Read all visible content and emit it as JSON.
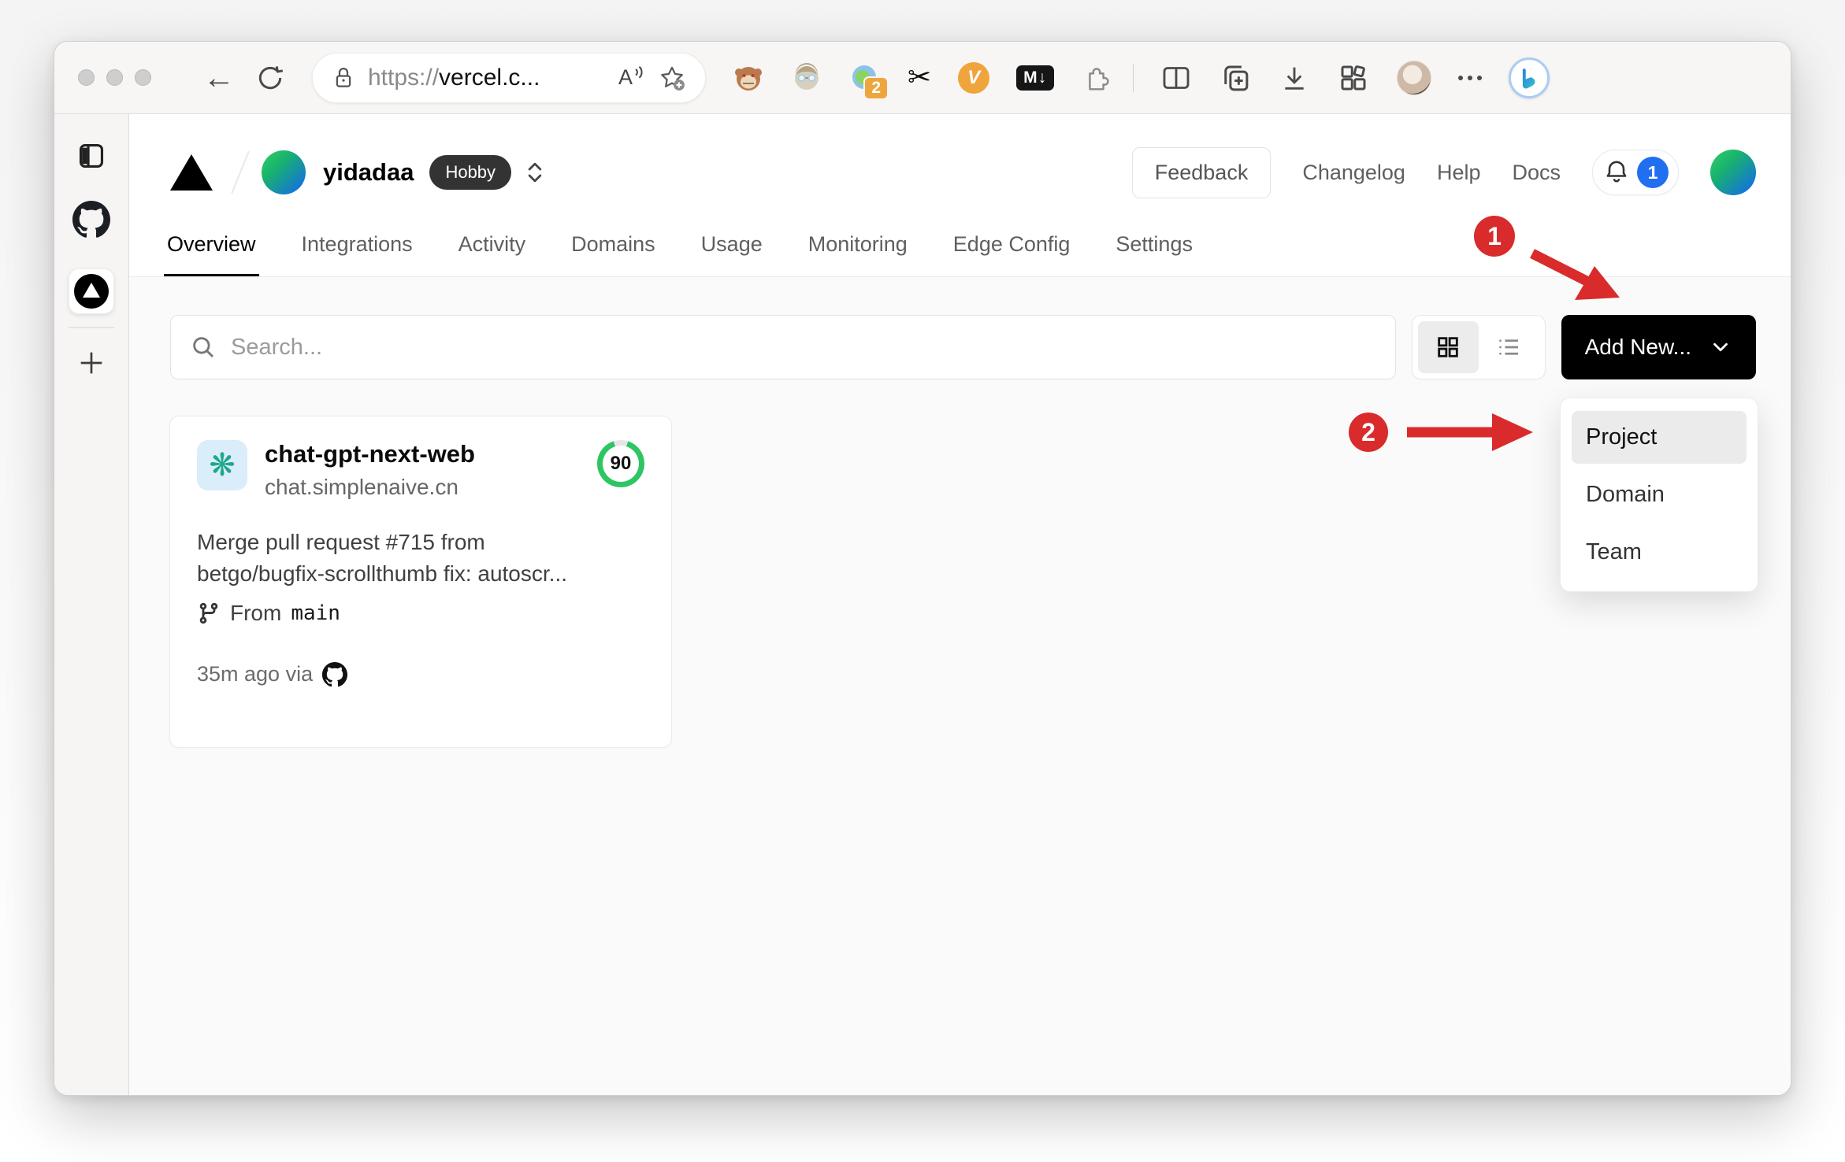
{
  "browser": {
    "url_scheme": "https://",
    "url_text": "vercel.c...",
    "read_aloud_label": "A",
    "tab_group_badge": "2",
    "vc_label": "V",
    "md_label": "M↓"
  },
  "vercel": {
    "header": {
      "team": "yidadaa",
      "plan": "Hobby",
      "feedback": "Feedback",
      "changelog": "Changelog",
      "help": "Help",
      "docs": "Docs",
      "bell_count": "1"
    },
    "nav": [
      "Overview",
      "Integrations",
      "Activity",
      "Domains",
      "Usage",
      "Monitoring",
      "Edge Config",
      "Settings"
    ],
    "controls": {
      "search_placeholder": "Search...",
      "add_new": "Add New..."
    },
    "menu": [
      "Project",
      "Domain",
      "Team"
    ],
    "project": {
      "name": "chat-gpt-next-web",
      "domain": "chat.simplenaive.cn",
      "score": "90",
      "commit_1": "Merge pull request #715 from",
      "commit_2": "betgo/bugfix-scrollthumb fix: autoscr...",
      "from_label": "From",
      "branch": "main",
      "meta": "35m ago via"
    }
  },
  "annotations": {
    "step1": "1",
    "step2": "2"
  },
  "colors": {
    "accent_green": "#2ec563",
    "notification_blue": "#1f6ff0",
    "annotation_red": "#d92b2b",
    "add_button_bg": "#000000",
    "hobby_badge_bg": "#333333",
    "openai_teal": "#21a789",
    "avatar_gradient": [
      "#2cc96a",
      "#1470e0"
    ]
  }
}
